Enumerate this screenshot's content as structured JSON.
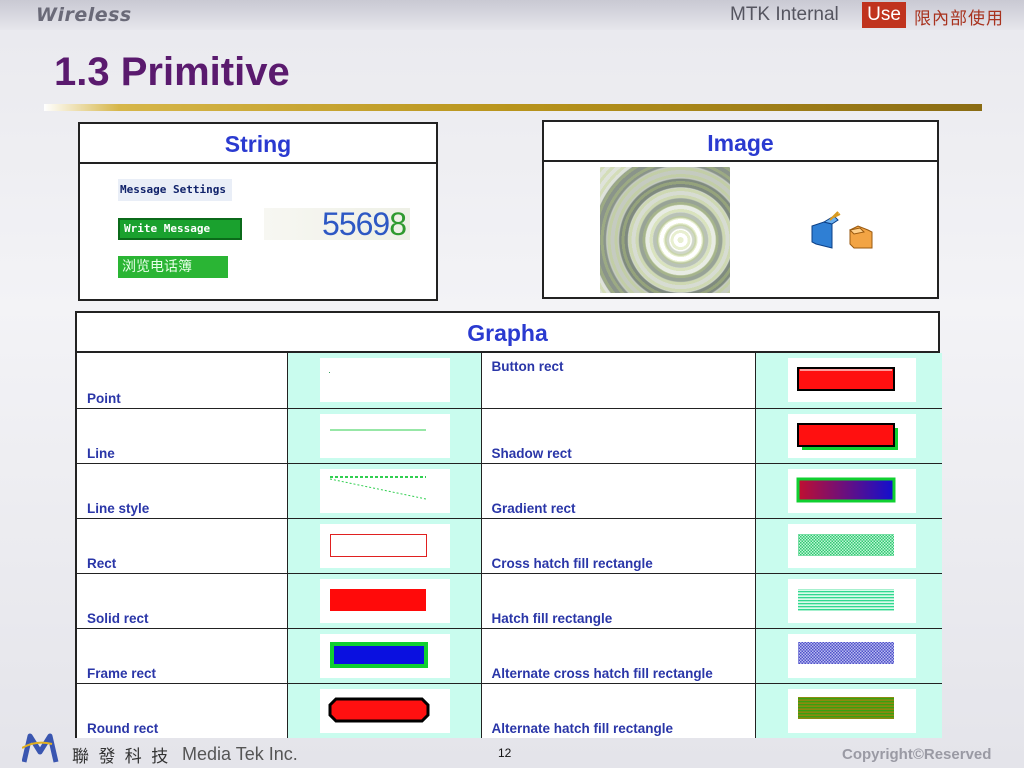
{
  "header": {
    "brand": "Wireless",
    "mtk_label": "MTK Internal",
    "use_label": "Use",
    "internal_cn": "限內部使用"
  },
  "title": "1.3 Primitive",
  "string_panel": {
    "heading": "String",
    "sample_menu": "Message Settings",
    "sample_button": "Write Message",
    "sample_cn": "浏览电话簿",
    "sample_number_part1": "55",
    "sample_number_part2": "69",
    "sample_number_part3": "8"
  },
  "image_panel": {
    "heading": "Image"
  },
  "grapha": {
    "heading": "Grapha",
    "rows": [
      {
        "left": "Point",
        "right": "Button rect",
        "right_top": true
      },
      {
        "left": "Line",
        "right": "Shadow rect"
      },
      {
        "left": "Line style",
        "right": "Gradient rect"
      },
      {
        "left": "Rect",
        "right": "Cross hatch fill rectangle"
      },
      {
        "left": "Solid rect",
        "right": "Hatch fill rectangle"
      },
      {
        "left": "Frame rect",
        "right": "Alternate cross hatch fill rectangle"
      },
      {
        "left": "Round rect",
        "right": "Alternate hatch fill rectangle"
      }
    ]
  },
  "footer": {
    "company_cn": "聯 發 科 技",
    "company": "Media Tek Inc.",
    "page_number": "12",
    "copyright": "Copyright©Reserved"
  },
  "colors": {
    "title": "#5a1a6e",
    "heading_blue": "#2a3ad0",
    "preview_bg": "#c9fcee",
    "use_red": "#c0331e"
  }
}
